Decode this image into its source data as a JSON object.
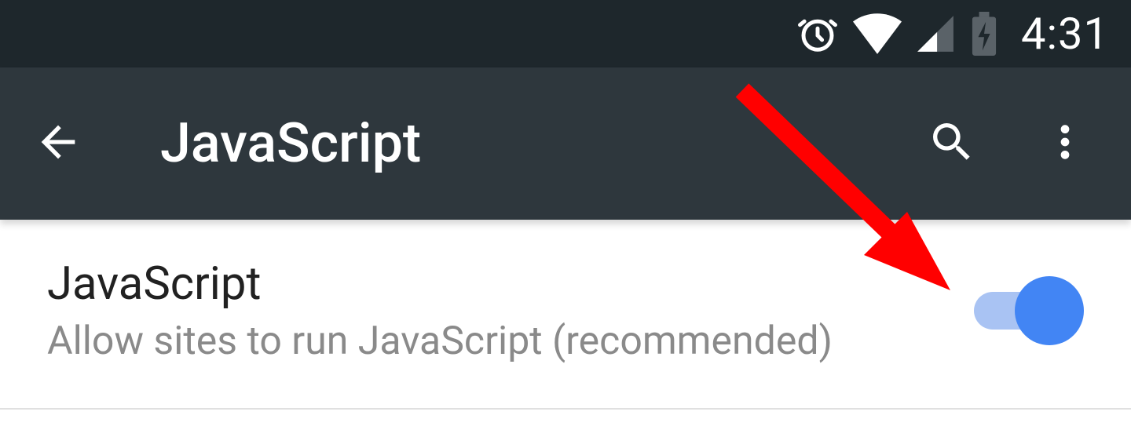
{
  "statusbar": {
    "time": "4:31"
  },
  "appbar": {
    "title": "JavaScript"
  },
  "setting": {
    "title": "JavaScript",
    "description": "Allow sites to run JavaScript (recommended)",
    "enabled": true
  }
}
